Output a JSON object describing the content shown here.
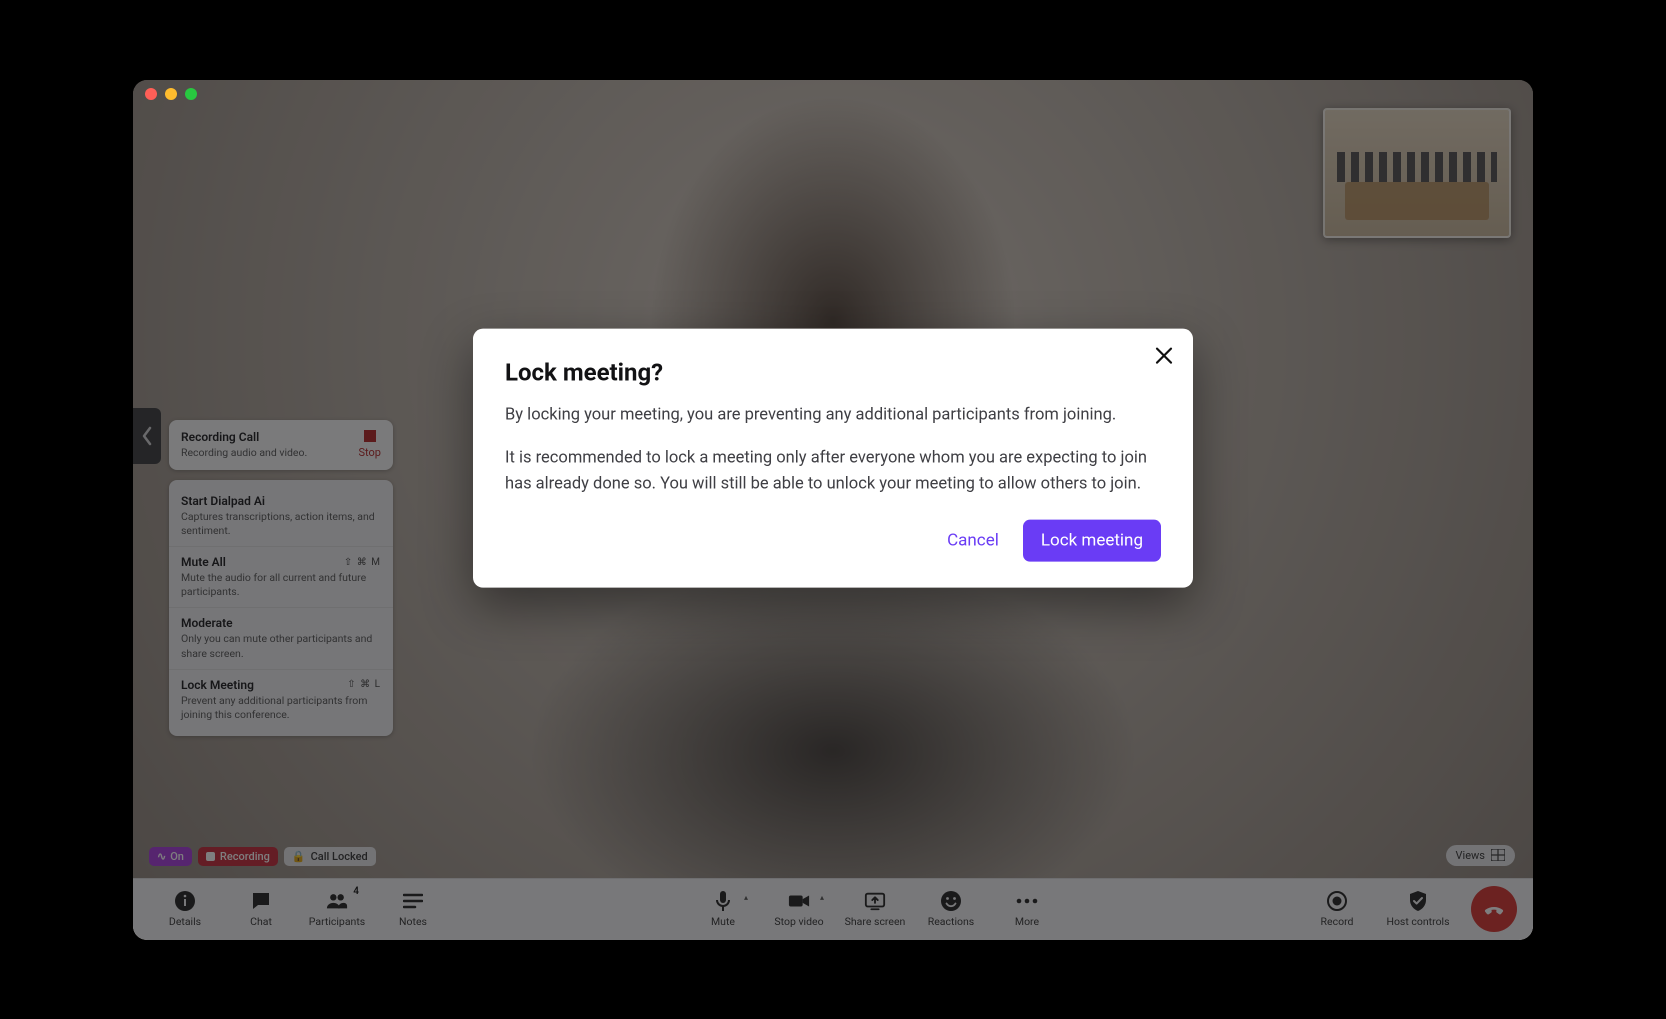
{
  "host_menu": {
    "recording": {
      "title": "Recording Call",
      "subtitle": "Recording audio and video.",
      "stop_label": "Stop"
    },
    "items": [
      {
        "title": "Start Dialpad Ai",
        "subtitle": "Captures transcriptions, action items, and sentiment.",
        "shortcut": ""
      },
      {
        "title": "Mute All",
        "subtitle": "Mute the audio for all current and future participants.",
        "shortcut": "⇧ ⌘ M"
      },
      {
        "title": "Moderate",
        "subtitle": "Only you can mute other participants and share screen.",
        "shortcut": ""
      },
      {
        "title": "Lock Meeting",
        "subtitle": "Prevent any additional participants from joining this conference.",
        "shortcut": "⇧ ⌘ L"
      }
    ]
  },
  "status": {
    "ai_label": "On",
    "recording_label": "Recording",
    "locked_label": "Call Locked"
  },
  "views_label": "Views",
  "toolbar": {
    "left": [
      {
        "key": "details",
        "label": "Details"
      },
      {
        "key": "chat",
        "label": "Chat"
      },
      {
        "key": "participants",
        "label": "Participants",
        "badge": "4"
      },
      {
        "key": "notes",
        "label": "Notes"
      }
    ],
    "center": [
      {
        "key": "mute",
        "label": "Mute",
        "caret": true
      },
      {
        "key": "stopvideo",
        "label": "Stop video",
        "caret": true
      },
      {
        "key": "sharescreen",
        "label": "Share screen"
      },
      {
        "key": "reactions",
        "label": "Reactions"
      },
      {
        "key": "more",
        "label": "More"
      }
    ],
    "right": [
      {
        "key": "record",
        "label": "Record"
      },
      {
        "key": "hostcontrols",
        "label": "Host controls"
      }
    ]
  },
  "modal": {
    "title": "Lock meeting?",
    "p1": "By locking your meeting, you are preventing any additional participants from joining.",
    "p2": "It is recommended to lock a meeting only after everyone whom you are expecting to join has already done so. You will still be able to unlock your meeting to allow others to join.",
    "cancel": "Cancel",
    "confirm": "Lock meeting"
  }
}
